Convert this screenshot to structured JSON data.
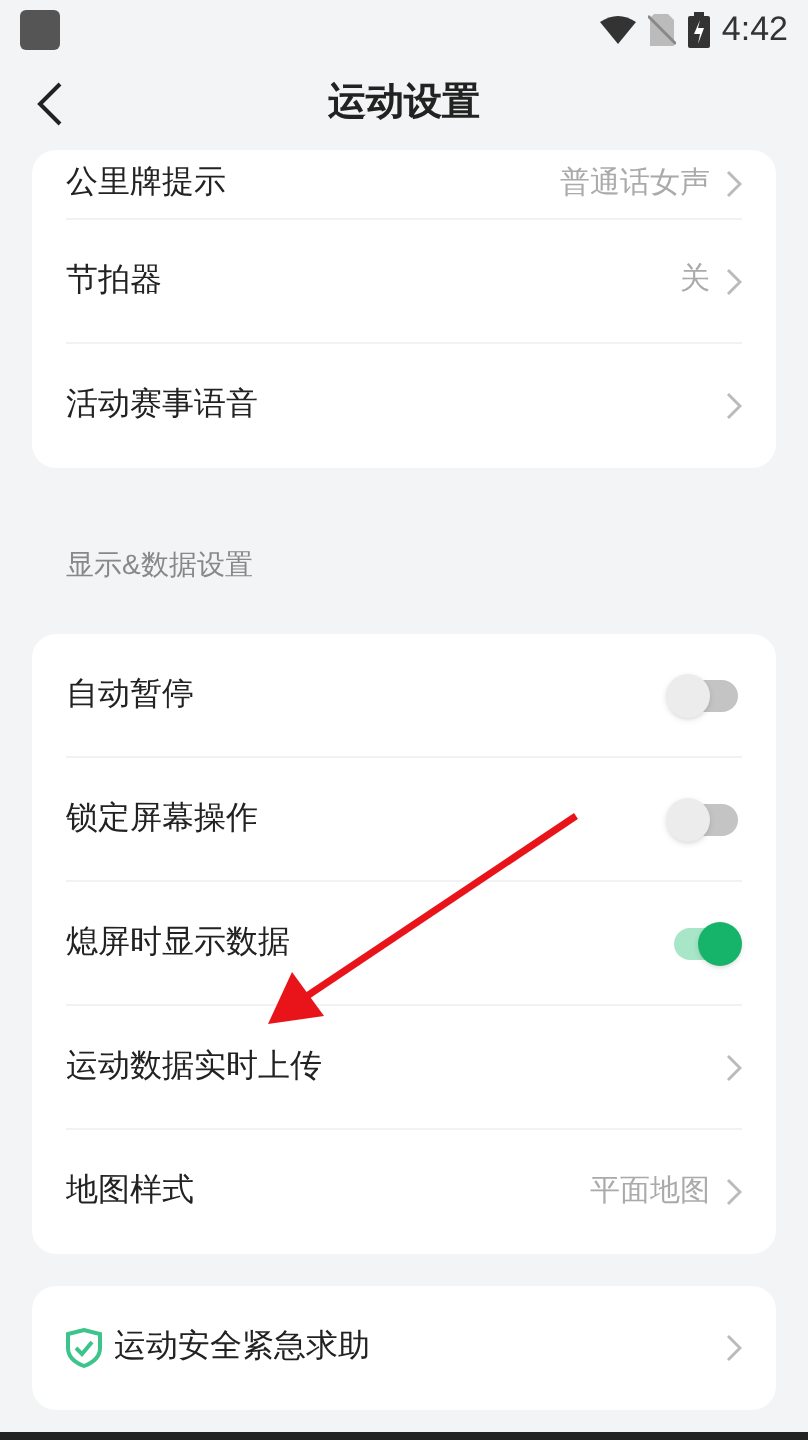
{
  "status_bar": {
    "time": "4:42"
  },
  "header": {
    "title": "运动设置"
  },
  "groups": [
    {
      "rows": [
        {
          "kind": "link",
          "label": "公里牌提示",
          "value": "普通话女声"
        },
        {
          "kind": "link",
          "label": "节拍器",
          "value": "关"
        },
        {
          "kind": "link",
          "label": "活动赛事语音"
        }
      ]
    },
    {
      "heading": "显示&数据设置",
      "rows": [
        {
          "kind": "toggle",
          "label": "自动暂停",
          "on": false
        },
        {
          "kind": "toggle",
          "label": "锁定屏幕操作",
          "on": false
        },
        {
          "kind": "toggle",
          "label": "熄屏时显示数据",
          "on": true
        },
        {
          "kind": "link",
          "label": "运动数据实时上传"
        },
        {
          "kind": "link",
          "label": "地图样式",
          "value": "平面地图"
        }
      ]
    },
    {
      "rows": [
        {
          "kind": "safety",
          "label": "运动安全紧急求助"
        }
      ]
    }
  ]
}
